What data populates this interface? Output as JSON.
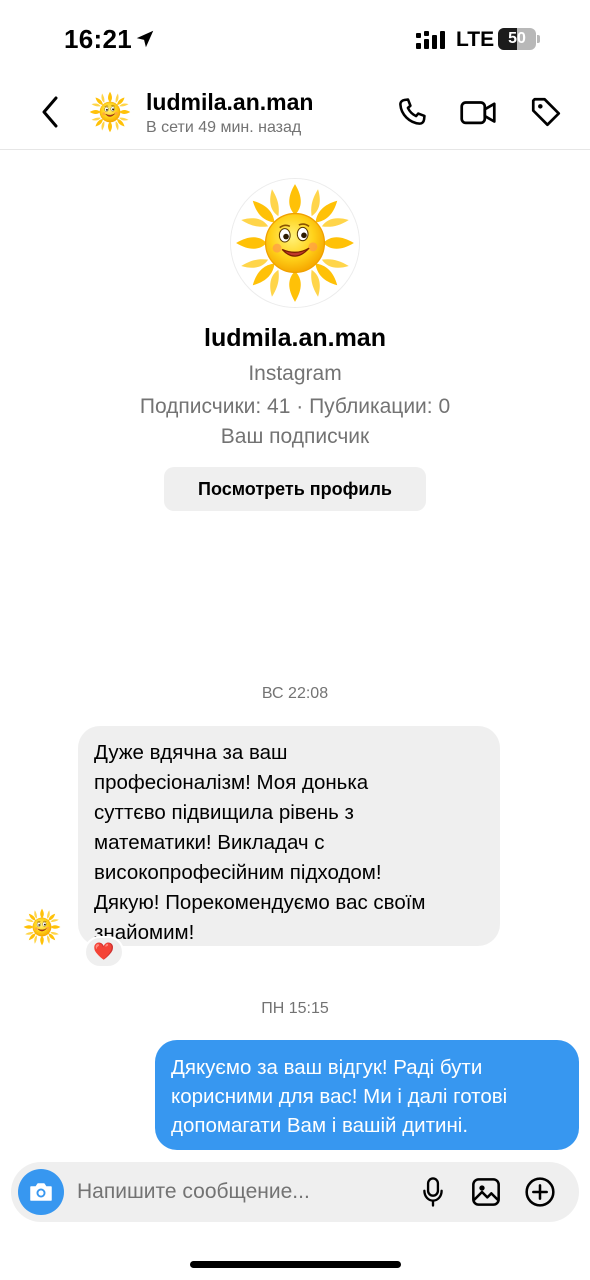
{
  "status_bar": {
    "time": "16:21",
    "network": "LTE",
    "battery": "50",
    "battery_level": 0.5,
    "icons": [
      "location-arrow-icon",
      "signal-icon",
      "battery-icon"
    ]
  },
  "header": {
    "username": "ludmila.an.man",
    "status": "В сети 49 мин. назад",
    "icons": [
      "back-chevron-icon",
      "sun-avatar",
      "phone-icon",
      "video-camera-icon",
      "tag-icon"
    ]
  },
  "profile": {
    "username": "ludmila.an.man",
    "platform": "Instagram",
    "stats": "Подписчики: 41 · Публикации: 0",
    "relation": "Ваш подписчик",
    "view_button": "Посмотреть профиль"
  },
  "thread": {
    "messages": [
      {
        "timestamp": "ВС 22:08",
        "direction": "incoming",
        "text": "Дуже вдячна за ваш\nпрофесіоналізм! Моя донька\nсуттєво підвищила рівень з\nматематики! Викладач с\nвисокопрофесійним підходом!\nДякую! Порекомендуємо вас своїм\nзнайомим!",
        "reaction": "❤️"
      },
      {
        "timestamp": "ПН 15:15",
        "direction": "outgoing",
        "text": "Дякуємо за ваш відгук! Раді бути\nкорисними для вас! Ми і далі готові\nдопомагати Вам і вашій дитині."
      }
    ]
  },
  "composer": {
    "placeholder": "Напишите сообщение...",
    "icons": [
      "camera-icon",
      "microphone-icon",
      "gallery-icon",
      "plus-circle-icon"
    ]
  },
  "colors": {
    "accent": "#3797f0",
    "bubble_incoming": "#efefef",
    "secondary_text": "#737373"
  }
}
